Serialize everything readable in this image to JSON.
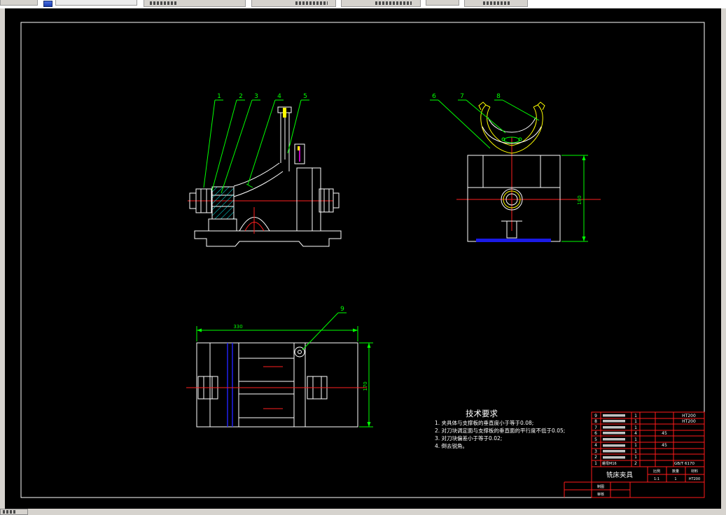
{
  "app": {
    "type": "cad-drawing-viewer",
    "canvas_bg": "#000000"
  },
  "colors": {
    "outline": "#ffffff",
    "centerline": "#ff2020",
    "leader_dim": "#00ff00",
    "auxiliary": "#ffff00",
    "hatch": "#00ffff",
    "datum": "#2222ff",
    "marker": "#ff00ff",
    "table_grid": "#ff1a1a"
  },
  "drawing": {
    "balloons": [
      "1",
      "2",
      "3",
      "4",
      "5",
      "6",
      "7",
      "8",
      "9"
    ],
    "dimensions": {
      "top_view_width": "330",
      "top_view_height": "170",
      "side_view_height": "180"
    },
    "tech_requirements": {
      "title": "技术要求",
      "items": [
        "1. 夹具体与支撑板的垂直度小于等于0.08;",
        "2. 对刀块调定面与支撑板的垂直面的平行度不低于0.05;",
        "3. 对刀块偏差小于等于0.02;",
        "4. 倒去锐角。"
      ]
    },
    "bom_rows": [
      [
        "9",
        "",
        "1",
        "",
        "HT200"
      ],
      [
        "8",
        "",
        "1",
        "",
        "HT200"
      ],
      [
        "7",
        "",
        "1",
        "",
        ""
      ],
      [
        "6",
        "",
        "4",
        "45",
        ""
      ],
      [
        "5",
        "",
        "1",
        "",
        ""
      ],
      [
        "4",
        "",
        "1",
        "45",
        ""
      ],
      [
        "3",
        "",
        "1",
        "",
        ""
      ],
      [
        "2",
        "",
        "1",
        "",
        ""
      ],
      [
        "1",
        "螺母M16",
        "2",
        "",
        "GB/T 6170"
      ]
    ],
    "title_block": {
      "title": "铣床夹具",
      "scale_label": "比例",
      "scale_value": "1:1",
      "qty_label": "数量",
      "qty_value": "1",
      "material_label": "材料",
      "material_value": "HT200",
      "draft_label": "制图",
      "audit_label": "审核"
    }
  }
}
